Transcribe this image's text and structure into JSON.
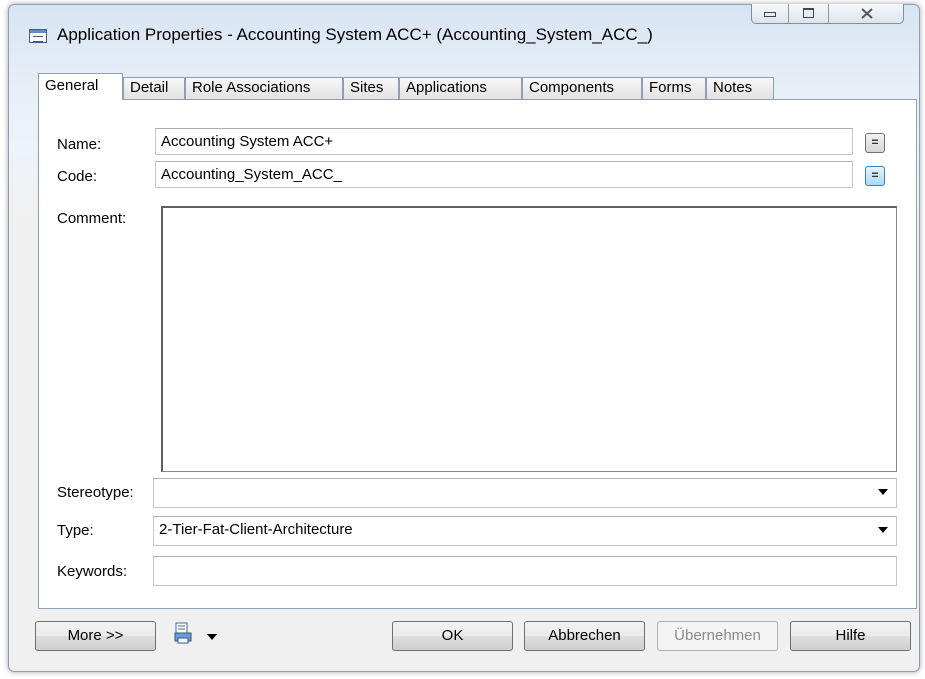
{
  "window": {
    "title": "Application Properties - Accounting System ACC+ (Accounting_System_ACC_)"
  },
  "tabs": [
    {
      "label": "General",
      "active": true
    },
    {
      "label": "Detail"
    },
    {
      "label": "Role Associations"
    },
    {
      "label": "Sites"
    },
    {
      "label": "Applications"
    },
    {
      "label": "Components"
    },
    {
      "label": "Forms"
    },
    {
      "label": "Notes"
    }
  ],
  "form": {
    "name_label": "Name:",
    "name_value": "Accounting System ACC+",
    "code_label": "Code:",
    "code_value": "Accounting_System_ACC_",
    "comment_label": "Comment:",
    "comment_value": "",
    "stereotype_label": "Stereotype:",
    "stereotype_value": "",
    "type_label": "Type:",
    "type_value": "2-Tier-Fat-Client-Architecture",
    "keywords_label": "Keywords:",
    "keywords_value": "",
    "eq_symbol": "="
  },
  "buttons": {
    "more": "More >>",
    "ok": "OK",
    "cancel": "Abbrechen",
    "apply": "Übernehmen",
    "help": "Hilfe"
  },
  "icons": {
    "app": "window-icon",
    "print": "print-icon",
    "close": "close-icon"
  },
  "colors": {
    "accent": "#3c7fb1",
    "tab_border": "#8e9eb5"
  }
}
